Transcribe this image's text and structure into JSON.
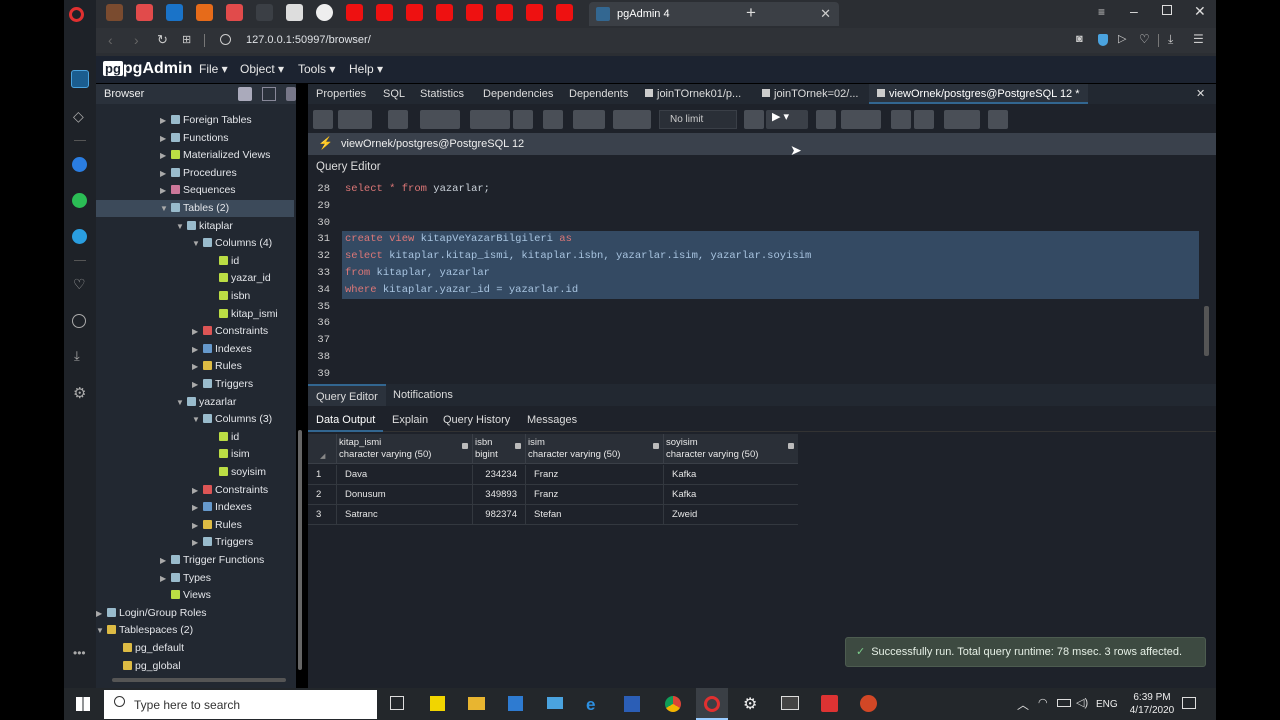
{
  "browser": {
    "active_tab": "pgAdmin 4",
    "url": "127.0.0.1:50997/browser/"
  },
  "pgadmin": {
    "logo": "pgAdmin",
    "menu": [
      "File",
      "Object",
      "Tools",
      "Help"
    ],
    "browser_title": "Browser",
    "tabs": [
      "Properties",
      "SQL",
      "Statistics",
      "Dependencies",
      "Dependents",
      "joinTOrnek01/p...",
      "joinTOrnek=02/...",
      "viewOrnek/postgres@PostgreSQL 12 *"
    ],
    "no_limit": "No limit",
    "connection": "viewOrnek/postgres@PostgreSQL 12",
    "query_editor_label": "Query Editor",
    "bottom_tabs": [
      "Query Editor",
      "Notifications"
    ],
    "output_tabs": [
      "Data Output",
      "Explain",
      "Query History",
      "Messages"
    ],
    "status": "Successfully run. Total query runtime: 78 msec. 3 rows affected."
  },
  "tree": [
    {
      "label": "Foreign Tables",
      "depth": 4,
      "tw": "▶",
      "color": "#9bc"
    },
    {
      "label": "Functions",
      "depth": 4,
      "tw": "▶",
      "color": "#9bc"
    },
    {
      "label": "Materialized Views",
      "depth": 4,
      "tw": "▶",
      "color": "#bd4"
    },
    {
      "label": "Procedures",
      "depth": 4,
      "tw": "▶",
      "color": "#9bc"
    },
    {
      "label": "Sequences",
      "depth": 4,
      "tw": "▶",
      "color": "#c79"
    },
    {
      "label": "Tables (2)",
      "depth": 4,
      "tw": "▼",
      "color": "#9bc"
    },
    {
      "label": "kitaplar",
      "depth": 5,
      "tw": "▼",
      "color": "#9bc"
    },
    {
      "label": "Columns (4)",
      "depth": 6,
      "tw": "▼",
      "color": "#9bc"
    },
    {
      "label": "id",
      "depth": 7,
      "tw": "",
      "color": "#bd4"
    },
    {
      "label": "yazar_id",
      "depth": 7,
      "tw": "",
      "color": "#bd4"
    },
    {
      "label": "isbn",
      "depth": 7,
      "tw": "",
      "color": "#bd4"
    },
    {
      "label": "kitap_ismi",
      "depth": 7,
      "tw": "",
      "color": "#bd4"
    },
    {
      "label": "Constraints",
      "depth": 6,
      "tw": "▶",
      "color": "#d55"
    },
    {
      "label": "Indexes",
      "depth": 6,
      "tw": "▶",
      "color": "#69c"
    },
    {
      "label": "Rules",
      "depth": 6,
      "tw": "▶",
      "color": "#db4"
    },
    {
      "label": "Triggers",
      "depth": 6,
      "tw": "▶",
      "color": "#9bc"
    },
    {
      "label": "yazarlar",
      "depth": 5,
      "tw": "▼",
      "color": "#9bc"
    },
    {
      "label": "Columns (3)",
      "depth": 6,
      "tw": "▼",
      "color": "#9bc"
    },
    {
      "label": "id",
      "depth": 7,
      "tw": "",
      "color": "#bd4"
    },
    {
      "label": "isim",
      "depth": 7,
      "tw": "",
      "color": "#bd4"
    },
    {
      "label": "soyisim",
      "depth": 7,
      "tw": "",
      "color": "#bd4"
    },
    {
      "label": "Constraints",
      "depth": 6,
      "tw": "▶",
      "color": "#d55"
    },
    {
      "label": "Indexes",
      "depth": 6,
      "tw": "▶",
      "color": "#69c"
    },
    {
      "label": "Rules",
      "depth": 6,
      "tw": "▶",
      "color": "#db4"
    },
    {
      "label": "Triggers",
      "depth": 6,
      "tw": "▶",
      "color": "#9bc"
    },
    {
      "label": "Trigger Functions",
      "depth": 4,
      "tw": "▶",
      "color": "#9bc"
    },
    {
      "label": "Types",
      "depth": 4,
      "tw": "▶",
      "color": "#9bc"
    },
    {
      "label": "Views",
      "depth": 4,
      "tw": "",
      "color": "#bd4"
    },
    {
      "label": "Login/Group Roles",
      "depth": 0,
      "tw": "▶",
      "color": "#9bc"
    },
    {
      "label": "Tablespaces (2)",
      "depth": 0,
      "tw": "▼",
      "color": "#db4"
    },
    {
      "label": "pg_default",
      "depth": 1,
      "tw": "",
      "color": "#db4"
    },
    {
      "label": "pg_global",
      "depth": 1,
      "tw": "",
      "color": "#db4"
    }
  ],
  "code": [
    {
      "n": "28",
      "text": "select * from yazarlar;",
      "sel": false
    },
    {
      "n": "29",
      "text": "",
      "sel": false
    },
    {
      "n": "30",
      "text": "",
      "sel": false
    },
    {
      "n": "31",
      "text": "create view kitapVeYazarBilgileri as",
      "sel": true
    },
    {
      "n": "32",
      "text": "select kitaplar.kitap_ismi, kitaplar.isbn, yazarlar.isim, yazarlar.soyisim",
      "sel": true
    },
    {
      "n": "33",
      "text": "from kitaplar, yazarlar",
      "sel": true
    },
    {
      "n": "34",
      "text": "where kitaplar.yazar_id = yazarlar.id",
      "sel": true
    },
    {
      "n": "35",
      "text": "",
      "sel": false
    },
    {
      "n": "36",
      "text": "",
      "sel": false
    },
    {
      "n": "37",
      "text": "",
      "sel": false
    },
    {
      "n": "38",
      "text": "",
      "sel": false
    },
    {
      "n": "39",
      "text": "",
      "sel": false
    }
  ],
  "grid": {
    "columns": [
      {
        "name": "kitap_ismi",
        "type": "character varying (50)"
      },
      {
        "name": "isbn",
        "type": "bigint"
      },
      {
        "name": "isim",
        "type": "character varying (50)"
      },
      {
        "name": "soyisim",
        "type": "character varying (50)"
      }
    ],
    "rows": [
      [
        "1",
        "Dava",
        "234234",
        "Franz",
        "Kafka"
      ],
      [
        "2",
        "Donusum",
        "349893",
        "Franz",
        "Kafka"
      ],
      [
        "3",
        "Satranc",
        "982374",
        "Stefan",
        "Zweid"
      ]
    ]
  },
  "taskbar": {
    "search": "Type here to search",
    "lang": "ENG",
    "time": "6:39 PM",
    "date": "4/17/2020"
  }
}
